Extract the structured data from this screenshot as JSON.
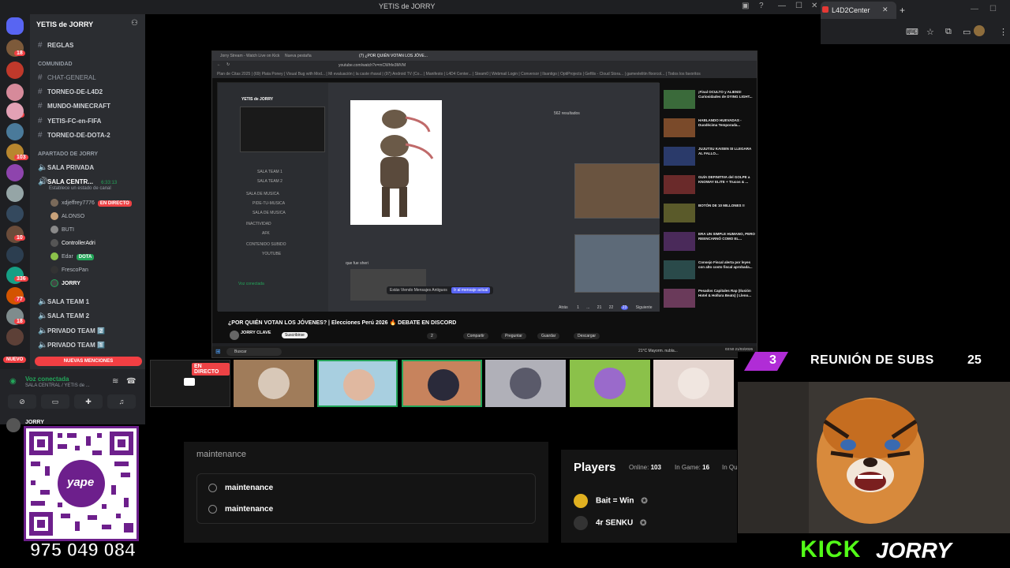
{
  "discord": {
    "window_title": "YETIS de JORRY",
    "guild_name": "YETIS de JORRY",
    "channels_top": [
      {
        "name": "REGLAS"
      }
    ],
    "category_comunidad": "COMUNIDAD",
    "channels_comunidad": [
      "CHAT-GENERAL",
      "TORNEO-DE-L4D2",
      "MUNDO-MINECRAFT",
      "YETIS-FC-en-FIFA",
      "TORNEO-DE-DOTA-2"
    ],
    "category_apartado": "APARTADO DE JORRY",
    "channels_apartado": [
      "SALA PRIVADA",
      "SALA CENTR..."
    ],
    "sala_central_time": "6:33:13",
    "sala_central_status": "Establece un estado de canal",
    "voice_users": [
      {
        "name": "xdjeffrey7776",
        "tag": "EN DIRECTO"
      },
      {
        "name": "ALONSO"
      },
      {
        "name": "BUTI"
      },
      {
        "name": "ControllerAdri"
      },
      {
        "name": "Edar",
        "tag": "DOTA"
      },
      {
        "name": "FrescoPan"
      },
      {
        "name": "JORRY"
      }
    ],
    "channels_after": [
      "SALA TEAM 1",
      "SALA TEAM 2",
      "PRIVADO TEAM 2️⃣",
      "PRIVADO TEAM 1️⃣"
    ],
    "nuevo_label": "NUEVO",
    "menciones_label": "NUEVAS MENCIONES",
    "voice_connected": "Voz conectada",
    "voice_channel": "SALA CENTRAL / YETIS de ...",
    "user_name": "JORRY",
    "server_badges": [
      "18",
      "",
      "11",
      "",
      "103",
      "",
      "",
      "10",
      "",
      "336",
      "77",
      "18",
      ""
    ]
  },
  "right_browser": {
    "tab_title": "L4D2Center"
  },
  "inner_browser": {
    "tabs": [
      "Jorry Stream - Watch Live on Kick",
      "Nueva pestaña",
      "(7) ¿POR QUIÉN VOTAN LOS JÓVE..."
    ],
    "url": "youtube.com/watch?v=mCWhfe3MVM",
    "bookmarks": "Plan de Citas 2025 | (69) Plata Poney | Visual Bug with Mod... | Mi evaluación | la caste rhaval | (97) Android TV (Co... | Manifesto | L4D4 Center... | Steam0 | Webmail Login | Conversor | Ilsantigo | OptiProjects | Gefilis - Cloud Stora... | gamevlelitin floorcol... | Todos los favoritos",
    "nested": {
      "guild": "YETIS de JORRY",
      "channels": [
        "SALA TEAM 1",
        "SALA TEAM 2",
        "SALA DE MUSICA",
        "PIDE-TU-MUSICA",
        "SALA DE MUSICA",
        "INACTIVIDAD",
        "AFK",
        "CONTENIDO SUBIDO",
        "YOUTUBE"
      ],
      "voice_conn": "Voz conectada",
      "results": "562 resultados",
      "pager": [
        "Atrás",
        "1",
        "...",
        "21",
        "22",
        "23",
        "Siguiente"
      ],
      "jump": "Estás Viendo Mensajes Antiguos",
      "jump_btn": "Ir al mensaje actual",
      "msg": "que fue sheri"
    },
    "yt_side": [
      "¡Final OCULTO y ALIENS! Curiosidades de DYING LIGHT...",
      "HABLANDO HUEVADAS - Duodécima Temporada...",
      "JUJUTSU KAISEN SI LLEGARA AL FALLO...",
      "GUÍA DEFINITIVA del GOLPE a KNOWAY ELITE + Trucos & ...",
      "BOTÓN DE 10 MILLONES !!",
      "ERA UN SIMPLE HUMANO, PERO REENCARNÓ COMO EL...",
      "Consejo Fiscal alerta por leyes con alto costo fiscal aprobada...",
      "Pesados Capitales Rap (Ilusión Hotel & Hollura Beats) | Lleno..."
    ],
    "video_title": "¿POR QUIÉN VOTAN LOS JÓVENES? | Elecciones Perú 2026 🔥 DEBATE EN DISCORD",
    "channel": "JORRY CLAVE",
    "subscribed": "Suscribirse",
    "actions": [
      "2",
      "Compartir",
      "Preguntar",
      "Guardar",
      "Descargar"
    ],
    "taskbar_search": "Buscar",
    "weather": "21°C Mayorm. nubla...",
    "clock": "03:50\n21/03/2026"
  },
  "participants": {
    "live_badge": "EN DIRECTO",
    "tile_colors": [
      "#a07c5a",
      "#a8cfe0",
      "#c7835d",
      "#b0b0b8",
      "#8bc14a",
      "#e4d5cf"
    ]
  },
  "l4d2": {
    "title": "maintenance",
    "options": [
      "maintenance",
      "maintenance"
    ],
    "players_title": "Players",
    "online_label": "Online:",
    "online_value": "103",
    "ingame_label": "In Game:",
    "ingame_value": "16",
    "inq_label": "In Qu",
    "players": [
      "Bait = Win",
      "4r SENKU"
    ]
  },
  "subs": {
    "current": "3",
    "label": "REUNIÓN DE SUBS",
    "goal": "25"
  },
  "kick": {
    "brand": "KICK",
    "user": "JORRY"
  },
  "qr": {
    "brand": "yape",
    "phone": "975 049 084"
  },
  "colors": {
    "discord_bg": "#2b2d31",
    "kick_green": "#53fc18",
    "live_red": "#ed4245",
    "qr_border": "#6d1f8c",
    "subs_accent": "#b02cd6"
  }
}
